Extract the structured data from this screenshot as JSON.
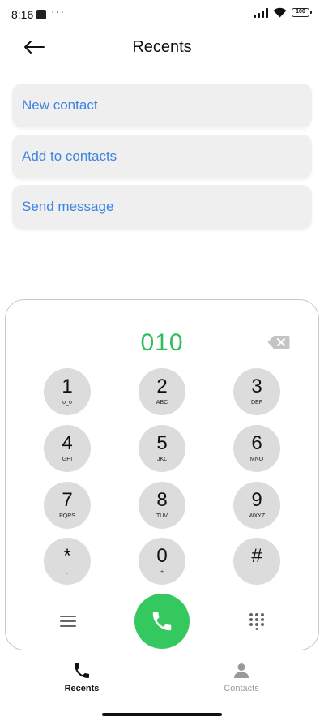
{
  "status_bar": {
    "time": "8:16",
    "dots": "···",
    "battery": "100"
  },
  "header": {
    "title": "Recents"
  },
  "actions": [
    {
      "label": "New contact"
    },
    {
      "label": "Add to contacts"
    },
    {
      "label": "Send message"
    }
  ],
  "dialpad": {
    "number": "010",
    "keys": [
      {
        "digit": "1",
        "letters": "o_o"
      },
      {
        "digit": "2",
        "letters": "ABC"
      },
      {
        "digit": "3",
        "letters": "DEF"
      },
      {
        "digit": "4",
        "letters": "GHI"
      },
      {
        "digit": "5",
        "letters": "JKL"
      },
      {
        "digit": "6",
        "letters": "MNO"
      },
      {
        "digit": "7",
        "letters": "PQRS"
      },
      {
        "digit": "8",
        "letters": "TUV"
      },
      {
        "digit": "9",
        "letters": "WXYZ"
      },
      {
        "digit": "*",
        "letters": ","
      },
      {
        "digit": "0",
        "letters": "+"
      },
      {
        "digit": "#",
        "letters": ""
      }
    ]
  },
  "bottom_nav": {
    "tabs": [
      {
        "label": "Recents",
        "icon": "phone-icon",
        "active": true
      },
      {
        "label": "Contacts",
        "icon": "person-icon",
        "active": false
      }
    ]
  },
  "colors": {
    "accent": "#3b84e0",
    "dialed": "#2fbf5f",
    "call": "#35c85f",
    "key": "#dcdcdc",
    "action_bg": "#efeff0"
  },
  "icons": [
    "back-arrow-icon",
    "backspace-icon",
    "menu-icon",
    "call-icon",
    "keypad-icon",
    "wifi-icon",
    "signal-icon",
    "battery-icon"
  ]
}
